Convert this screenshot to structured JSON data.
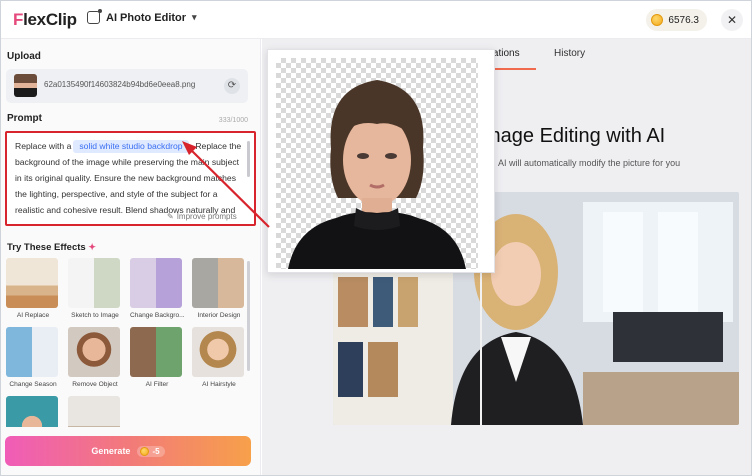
{
  "header": {
    "logo_text": "lexClip",
    "logo_initial": "F",
    "editor_label": "AI Photo Editor",
    "credits": "6576.3"
  },
  "left": {
    "upload_title": "Upload",
    "filename": "62a0135490f14603824b94bd6e0eea8.png",
    "prompt_title": "Prompt",
    "counter": "333/1000",
    "prompt_before": "Replace with a",
    "prompt_tag": "solid white studio backdrop",
    "prompt_after": ". Replace the background of the image while preserving the main subject in its original quality. Ensure the new background matches the lighting, perspective, and style of the subject for a realistic and cohesive result. Blend shadows naturally and",
    "improve_label": "Improve prompts",
    "effects_title": "Try These Effects",
    "effects": [
      {
        "label": "AI Replace"
      },
      {
        "label": "Sketch to Image"
      },
      {
        "label": "Change Backgro..."
      },
      {
        "label": "Interior Design"
      },
      {
        "label": "Change Season"
      },
      {
        "label": "Remove Object"
      },
      {
        "label": "AI Filter"
      },
      {
        "label": "AI Hairstyle"
      },
      {
        "label": ""
      },
      {
        "label": ""
      }
    ],
    "generate_label": "Generate",
    "generate_cost": "-5"
  },
  "right": {
    "tab_creations": "reations",
    "tab_history": "History",
    "hero_title": "mage Editing with AI",
    "hero_subtitle": "AI will automatically modify the picture for you"
  },
  "colors": {
    "accent_pink": "#e64a7d",
    "highlight_red": "#d8242d",
    "tag_blue": "#3a6ff2",
    "tab_underline": "#f06a4e"
  }
}
